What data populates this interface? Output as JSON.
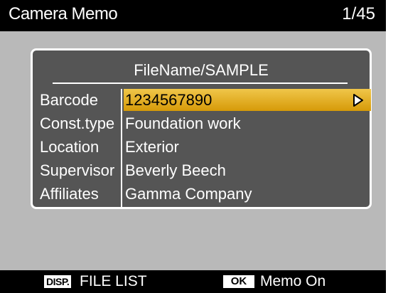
{
  "header": {
    "title": "Camera Memo",
    "page_count": "1/45"
  },
  "panel": {
    "file_name": "FileName/SAMPLE",
    "rows": [
      {
        "label": "Barcode",
        "value": "1234567890",
        "selected": true
      },
      {
        "label": "Const.type",
        "value": "Foundation work",
        "selected": false
      },
      {
        "label": "Location",
        "value": "Exterior",
        "selected": false
      },
      {
        "label": "Supervisor",
        "value": "Beverly Beech",
        "selected": false
      },
      {
        "label": "Affiliates",
        "value": "Gamma Company",
        "selected": false
      }
    ]
  },
  "footer": {
    "disp_key": "DISP.",
    "disp_label": "FILE LIST",
    "ok_key": "OK",
    "ok_label": "Memo On"
  },
  "colors": {
    "title_bar": "#000000",
    "screen_background": "#b9b9b9",
    "panel_background": "#555555",
    "selection_highlight": "#e8b323"
  },
  "icons": {
    "row_arrow": "triangle-right-icon"
  }
}
